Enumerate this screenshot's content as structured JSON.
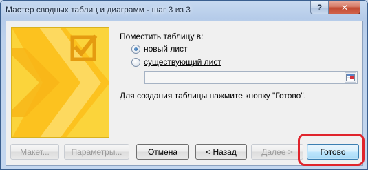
{
  "window": {
    "title": "Мастер сводных таблиц и диаграмм - шаг 3 из 3",
    "help_glyph": "?",
    "close_glyph": "✕"
  },
  "placement": {
    "heading": "Поместить таблицу в:",
    "options": [
      {
        "label": "новый лист",
        "selected": true
      },
      {
        "label": "существующий лист",
        "selected": false
      }
    ],
    "range_value": ""
  },
  "hint": "Для создания таблицы нажмите кнопку \"Готово\".",
  "buttons": {
    "layout": "Макет...",
    "options": "Параметры...",
    "cancel": "Отмена",
    "back_prefix": "< ",
    "back": "Назад",
    "next": "Далее >",
    "finish": "Готово"
  },
  "annotation": {
    "highlight_color": "#e0242c"
  },
  "colors": {
    "art_yellow": "#fbd43b",
    "default_button_border": "#3c7fb1"
  }
}
